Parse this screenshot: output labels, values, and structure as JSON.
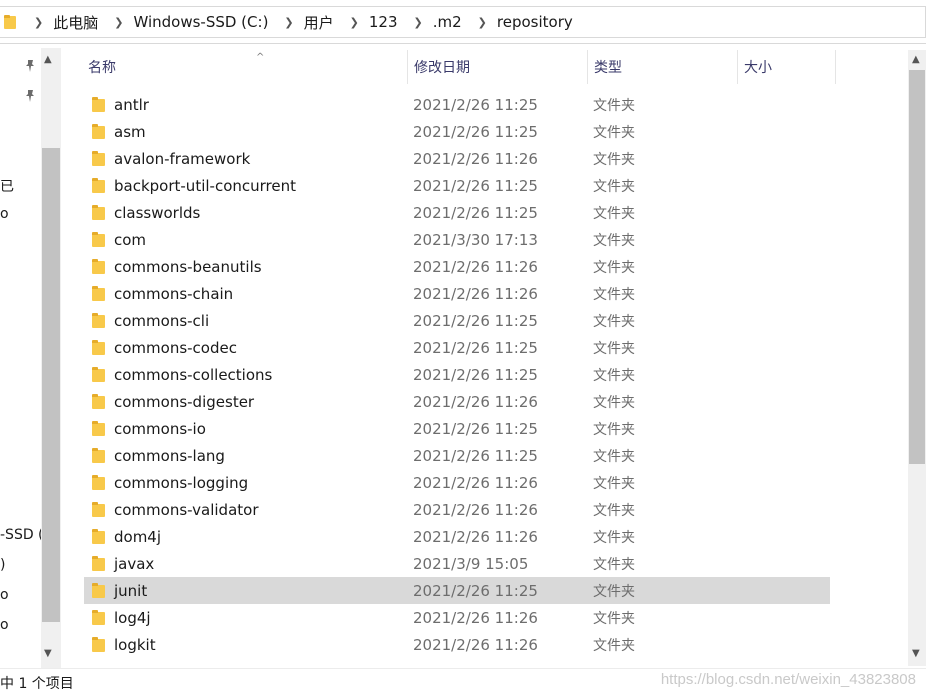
{
  "breadcrumb": {
    "items": [
      "此电脑",
      "Windows-SSD (C:)",
      "用户",
      "123",
      ".m2",
      "repository"
    ]
  },
  "nav": {
    "pin_icon": "pin-icon",
    "items": [
      "已",
      "o",
      "-SSD (",
      ")",
      "o",
      "o"
    ]
  },
  "columns": {
    "name": "名称",
    "date": "修改日期",
    "type": "类型",
    "size": "大小"
  },
  "files": [
    {
      "name": "antlr",
      "date": "2021/2/26 11:25",
      "type": "文件夹"
    },
    {
      "name": "asm",
      "date": "2021/2/26 11:25",
      "type": "文件夹"
    },
    {
      "name": "avalon-framework",
      "date": "2021/2/26 11:26",
      "type": "文件夹"
    },
    {
      "name": "backport-util-concurrent",
      "date": "2021/2/26 11:25",
      "type": "文件夹"
    },
    {
      "name": "classworlds",
      "date": "2021/2/26 11:25",
      "type": "文件夹"
    },
    {
      "name": "com",
      "date": "2021/3/30 17:13",
      "type": "文件夹"
    },
    {
      "name": "commons-beanutils",
      "date": "2021/2/26 11:26",
      "type": "文件夹"
    },
    {
      "name": "commons-chain",
      "date": "2021/2/26 11:26",
      "type": "文件夹"
    },
    {
      "name": "commons-cli",
      "date": "2021/2/26 11:25",
      "type": "文件夹"
    },
    {
      "name": "commons-codec",
      "date": "2021/2/26 11:25",
      "type": "文件夹"
    },
    {
      "name": "commons-collections",
      "date": "2021/2/26 11:25",
      "type": "文件夹"
    },
    {
      "name": "commons-digester",
      "date": "2021/2/26 11:26",
      "type": "文件夹"
    },
    {
      "name": "commons-io",
      "date": "2021/2/26 11:25",
      "type": "文件夹"
    },
    {
      "name": "commons-lang",
      "date": "2021/2/26 11:25",
      "type": "文件夹"
    },
    {
      "name": "commons-logging",
      "date": "2021/2/26 11:26",
      "type": "文件夹"
    },
    {
      "name": "commons-validator",
      "date": "2021/2/26 11:26",
      "type": "文件夹"
    },
    {
      "name": "dom4j",
      "date": "2021/2/26 11:26",
      "type": "文件夹"
    },
    {
      "name": "javax",
      "date": "2021/3/9 15:05",
      "type": "文件夹"
    },
    {
      "name": "junit",
      "date": "2021/2/26 11:25",
      "type": "文件夹",
      "selected": true
    },
    {
      "name": "log4j",
      "date": "2021/2/26 11:26",
      "type": "文件夹"
    },
    {
      "name": "logkit",
      "date": "2021/2/26 11:26",
      "type": "文件夹"
    }
  ],
  "status": {
    "text": "中 1 个项目"
  },
  "watermark": "https://blog.csdn.net/weixin_43823808",
  "colors": {
    "folder": "#f8c94a",
    "selection": "#d9d9d9",
    "header_text": "#3a3a6a"
  }
}
